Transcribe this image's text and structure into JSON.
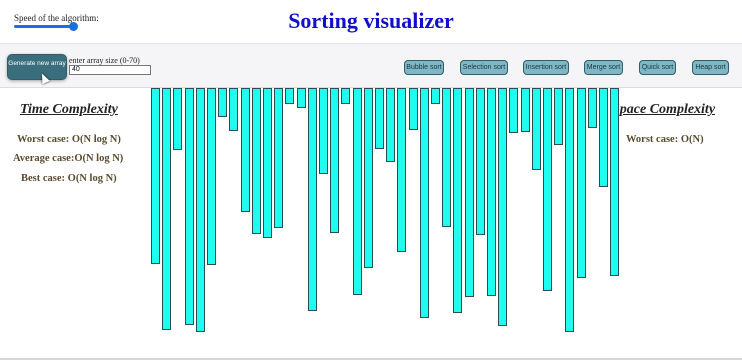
{
  "header": {
    "speed_label": "Speed of the algorithm:",
    "title": "Sorting visualizer",
    "speed_value": 1.0
  },
  "toolbar": {
    "generate_label": "Generate new array",
    "size_label": "enter array size (0-70)",
    "size_value": "40",
    "algorithms": [
      "Bubble sort",
      "Selection sort",
      "Insertion sort",
      "Merge sort",
      "Quick sort",
      "Heap sort"
    ]
  },
  "time_complexity": {
    "title": "Time Complexity",
    "worst": "Worst case: O(N log N)",
    "average": "Average case:O(N log N)",
    "best": "Best case: O(N log N)"
  },
  "space_complexity": {
    "title": "Space Complexity",
    "worst": "Worst case: O(N)"
  },
  "array": [
    176,
    242,
    62,
    237,
    244,
    177,
    29,
    43,
    124,
    146,
    150,
    140,
    16,
    20,
    223,
    86,
    145,
    16,
    207,
    180,
    61,
    74,
    164,
    42,
    230,
    16,
    139,
    225,
    209,
    147,
    208,
    238,
    45,
    44,
    82,
    203,
    57,
    244,
    190,
    40,
    99,
    188
  ]
}
